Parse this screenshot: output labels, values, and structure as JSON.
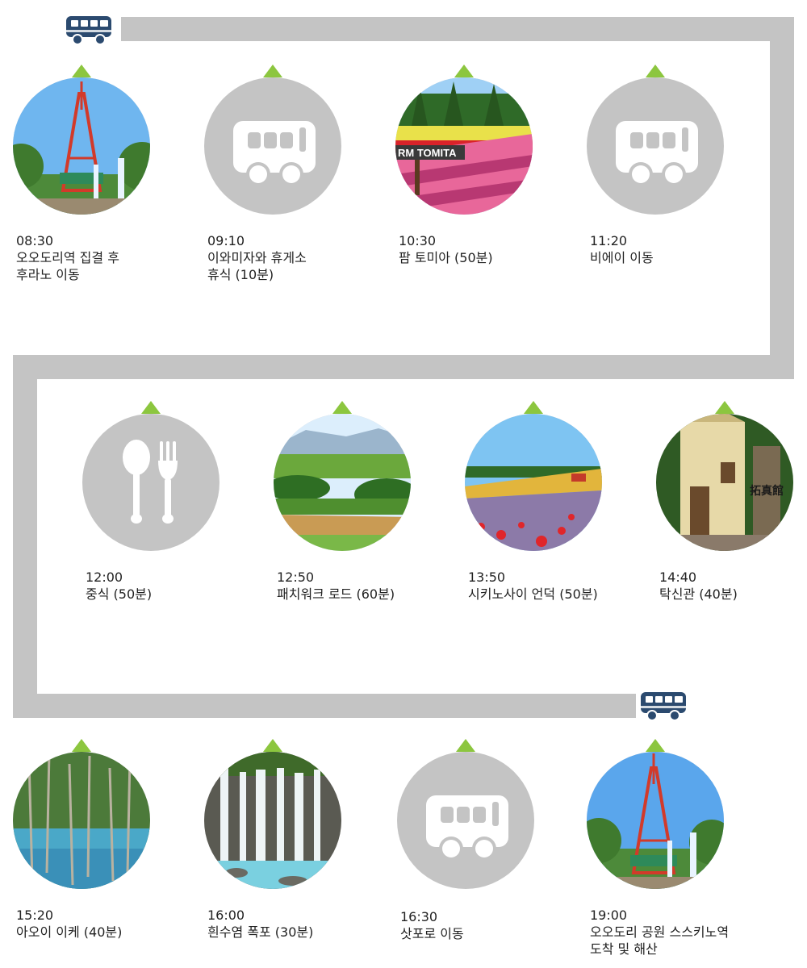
{
  "colors": {
    "track": "#c4c4c4",
    "marker": "#8cc63f",
    "icon_bg": "#c4c4c4",
    "bus": "#2b4a6f"
  },
  "stops": [
    {
      "time": "08:30",
      "desc1": "오오도리역 집결 후",
      "desc2": "후라노 이동",
      "icon": "sapporo-tv-tower-photo"
    },
    {
      "time": "09:10",
      "desc1": "이와미자와 휴게소",
      "desc2": "휴식 (10분)",
      "icon": "bus-icon"
    },
    {
      "time": "10:30",
      "desc1": "팜 토미아 (50분)",
      "desc2": "",
      "icon": "farm-tomita-photo",
      "sign_text": "RM TOMITA"
    },
    {
      "time": "11:20",
      "desc1": "비에이 이동",
      "desc2": "",
      "icon": "bus-icon"
    },
    {
      "time": "12:00",
      "desc1": "중식 (50분)",
      "desc2": "",
      "icon": "spoon-fork-icon"
    },
    {
      "time": "12:50",
      "desc1": "패치워크 로드 (60분)",
      "desc2": "",
      "icon": "patchwork-road-photo"
    },
    {
      "time": "13:50",
      "desc1": "시키노사이 언덕 (50분)",
      "desc2": "",
      "icon": "shikisai-hill-photo"
    },
    {
      "time": "14:40",
      "desc1": "탁신관 (40분)",
      "desc2": "",
      "icon": "takushinkan-photo",
      "sign_text": "拓真館"
    },
    {
      "time": "15:20",
      "desc1": "아오이 이케 (40분)",
      "desc2": "",
      "icon": "blue-pond-photo"
    },
    {
      "time": "16:00",
      "desc1": "흰수염 폭포 (30분)",
      "desc2": "",
      "icon": "shirahige-falls-photo"
    },
    {
      "time": "16:30",
      "desc1": "삿포로 이동",
      "desc2": "",
      "icon": "bus-icon"
    },
    {
      "time": "19:00",
      "desc1": "오오도리 공원 스스키노역",
      "desc2": "도착 및 해산",
      "icon": "sapporo-tv-tower-photo"
    }
  ]
}
